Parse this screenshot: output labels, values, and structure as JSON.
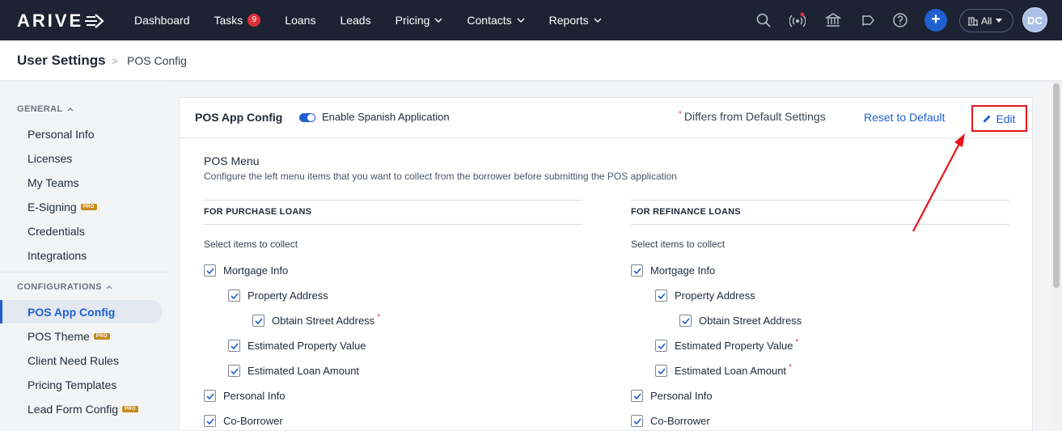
{
  "brand": {
    "logo_text": "ARIVE"
  },
  "topnav": {
    "items": [
      {
        "label": "Dashboard"
      },
      {
        "label": "Tasks",
        "badge": "9"
      },
      {
        "label": "Loans"
      },
      {
        "label": "Leads"
      },
      {
        "label": "Pricing",
        "dropdown": true
      },
      {
        "label": "Contacts",
        "dropdown": true
      },
      {
        "label": "Reports",
        "dropdown": true
      }
    ],
    "icons": [
      "search-icon",
      "broadcast-icon",
      "bank-icon",
      "megaphone-icon",
      "help-icon"
    ],
    "filter_label": "All",
    "avatar_initials": "DC"
  },
  "breadcrumb": {
    "title": "User Settings",
    "separator": ">",
    "page": "POS Config"
  },
  "sidebar": {
    "general_heading": "GENERAL",
    "general_items": [
      {
        "label": "Personal Info"
      },
      {
        "label": "Licenses"
      },
      {
        "label": "My Teams"
      },
      {
        "label": "E-Signing",
        "pro": "PRO"
      },
      {
        "label": "Credentials"
      },
      {
        "label": "Integrations"
      }
    ],
    "config_heading": "CONFIGURATIONS",
    "config_items": [
      {
        "label": "POS App Config",
        "active": true
      },
      {
        "label": "POS Theme",
        "pro": "PRO"
      },
      {
        "label": "Client Need Rules"
      },
      {
        "label": "Pricing Templates"
      },
      {
        "label": "Lead Form Config",
        "pro": "PRO"
      }
    ]
  },
  "card": {
    "title": "POS App Config",
    "toggle_label": "Enable Spanish Application",
    "toggle_on": true,
    "differs_label": "Differs from Default Settings",
    "differs_marker": "*",
    "reset_label": "Reset to Default",
    "edit_label": "Edit",
    "section_title": "POS Menu",
    "section_subtitle": "Configure the left menu items that you want to collect from the borrower before submitting the POS application",
    "purchase": {
      "heading": "FOR PURCHASE LOANS",
      "select_label": "Select items to collect",
      "items": [
        {
          "label": "Mortgage Info",
          "checked": true,
          "differs": false
        },
        {
          "label": "Property Address",
          "checked": true,
          "differs": false
        },
        {
          "label": "Obtain Street Address",
          "checked": true,
          "differs": true
        },
        {
          "label": "Estimated Property Value",
          "checked": true,
          "differs": false
        },
        {
          "label": "Estimated Loan Amount",
          "checked": true,
          "differs": false
        },
        {
          "label": "Personal Info",
          "checked": true,
          "differs": false
        },
        {
          "label": "Co-Borrower",
          "checked": true,
          "differs": false
        }
      ]
    },
    "refinance": {
      "heading": "FOR REFINANCE LOANS",
      "select_label": "Select items to collect",
      "items": [
        {
          "label": "Mortgage Info",
          "checked": true,
          "differs": false
        },
        {
          "label": "Property Address",
          "checked": true,
          "differs": false
        },
        {
          "label": "Obtain Street Address",
          "checked": true,
          "differs": false
        },
        {
          "label": "Estimated Property Value",
          "checked": true,
          "differs": true
        },
        {
          "label": "Estimated Loan Amount",
          "checked": true,
          "differs": true
        },
        {
          "label": "Personal Info",
          "checked": true,
          "differs": false
        },
        {
          "label": "Co-Borrower",
          "checked": true,
          "differs": false
        }
      ]
    }
  },
  "colors": {
    "nav_bg": "#1d2333",
    "accent": "#1f5fcf",
    "required": "#e0303a",
    "highlight": "#e8141c"
  }
}
